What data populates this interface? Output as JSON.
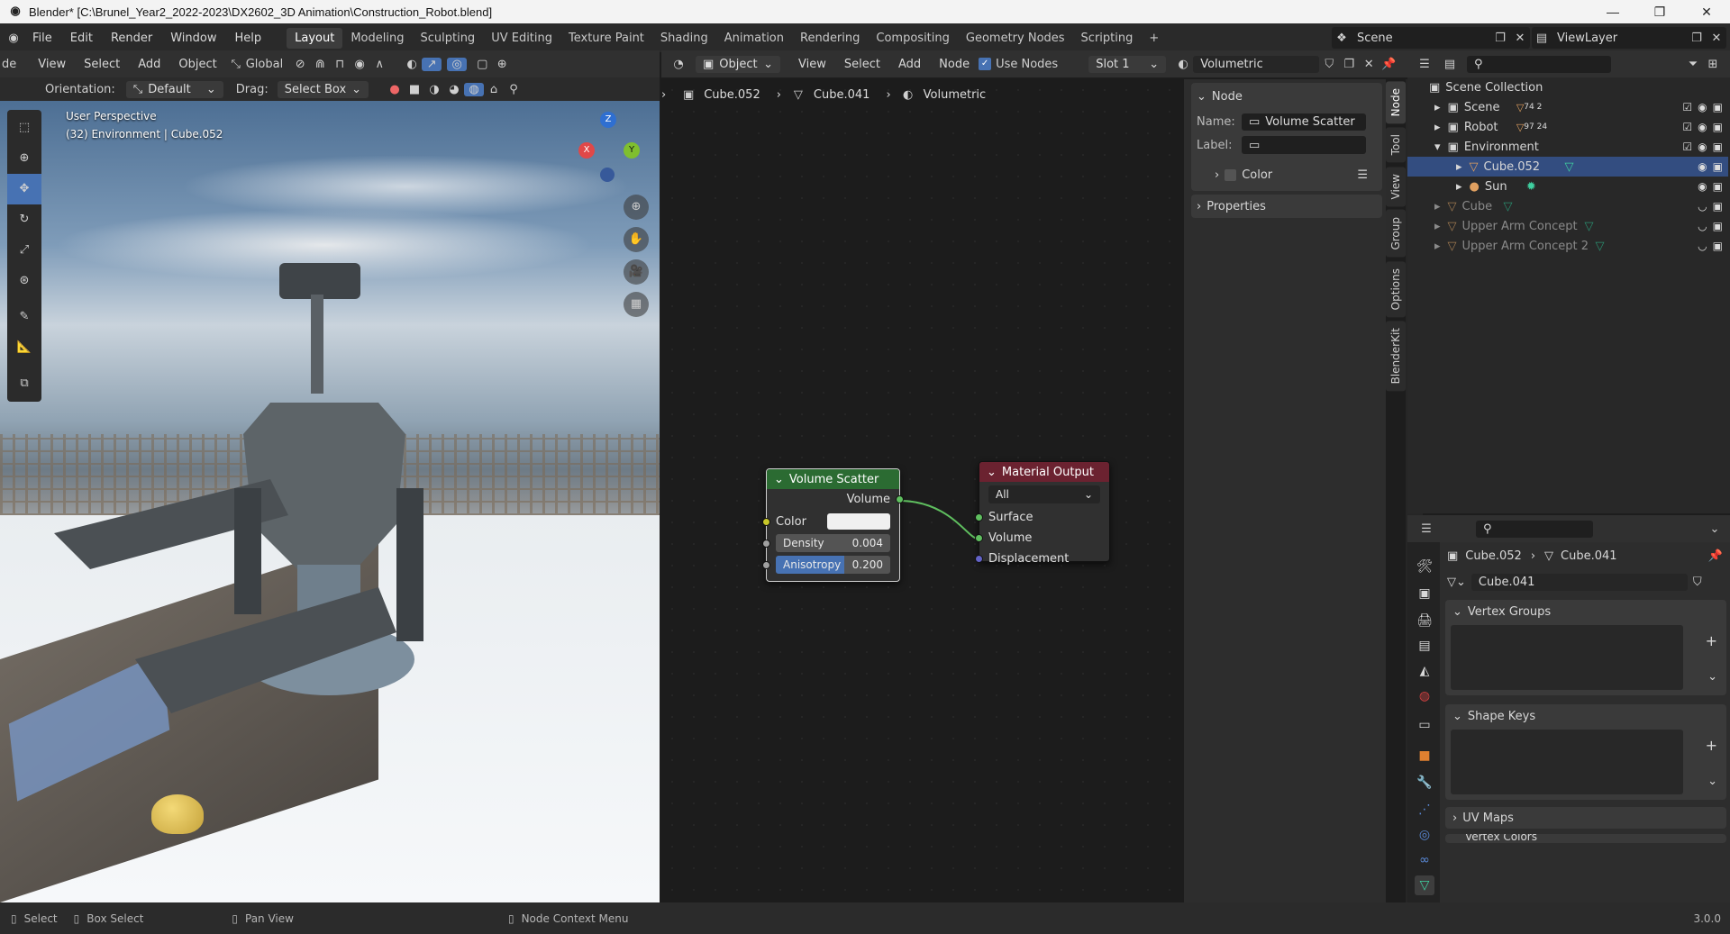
{
  "window": {
    "title": "Blender* [C:\\Brunel_Year2_2022-2023\\DX2602_3D Animation\\Construction_Robot.blend]",
    "minimize": "—",
    "maximize": "❐",
    "close": "✕"
  },
  "menu": {
    "items": [
      "File",
      "Edit",
      "Render",
      "Window",
      "Help"
    ],
    "workspaces": [
      "Layout",
      "Modeling",
      "Sculpting",
      "UV Editing",
      "Texture Paint",
      "Shading",
      "Animation",
      "Rendering",
      "Compositing",
      "Geometry Nodes",
      "Scripting"
    ],
    "add_ws": "+",
    "scene_label": "Scene",
    "viewlayer_label": "ViewLayer"
  },
  "viewport_header": {
    "mode": "de",
    "menus": [
      "View",
      "Select",
      "Add",
      "Object"
    ],
    "transform": "Global",
    "orientation_label": "Orientation:",
    "orientation_value": "Default",
    "drag_label": "Drag:",
    "drag_value": "Select Box"
  },
  "viewport": {
    "perspective": "User Perspective",
    "context": "(32) Environment | Cube.052",
    "gizmo": {
      "z": "Z",
      "x": "X",
      "y": "Y"
    }
  },
  "node_header": {
    "object_type": "Object",
    "menus": [
      "View",
      "Select",
      "Add",
      "Node"
    ],
    "use_nodes": "Use Nodes",
    "slot": "Slot 1",
    "material": "Volumetric"
  },
  "breadcrumb": [
    "Cube.052",
    "Cube.041",
    "Volumetric"
  ],
  "nodes": {
    "volume_scatter": {
      "title": "Volume Scatter",
      "output": "Volume",
      "color_label": "Color",
      "density_label": "Density",
      "density_value": "0.004",
      "anisotropy_label": "Anisotropy",
      "anisotropy_value": "0.200"
    },
    "material_output": {
      "title": "Material Output",
      "target": "All",
      "inputs": [
        "Surface",
        "Volume",
        "Displacement"
      ]
    }
  },
  "node_sidebar": {
    "section": "Node",
    "name_label": "Name:",
    "name_value": "Volume Scatter",
    "label_label": "Label:",
    "color": "Color",
    "properties": "Properties",
    "tabs": [
      "Node",
      "Tool",
      "View",
      "Group",
      "Options",
      "BlenderKit"
    ]
  },
  "outliner": {
    "root": "Scene Collection",
    "rows": [
      {
        "name": "Scene",
        "badge": "74  2"
      },
      {
        "name": "Robot",
        "badge": "97  24"
      },
      {
        "name": "Environment",
        "badge": ""
      },
      {
        "name": "Cube.052",
        "badge": ""
      },
      {
        "name": "Sun",
        "badge": ""
      },
      {
        "name": "Cube",
        "badge": ""
      },
      {
        "name": "Upper Arm Concept",
        "badge": ""
      },
      {
        "name": "Upper Arm Concept 2",
        "badge": ""
      }
    ]
  },
  "properties": {
    "breadcrumb_obj": "Cube.052",
    "breadcrumb_mesh": "Cube.041",
    "mesh_name": "Cube.041",
    "vertex_groups": "Vertex Groups",
    "shape_keys": "Shape Keys",
    "uv_maps": "UV Maps",
    "vertex_colors": "Vertex Colors"
  },
  "status": {
    "select": "Select",
    "box_select": "Box Select",
    "pan_view": "Pan View",
    "node_context": "Node Context Menu",
    "version": "3.0.0"
  },
  "colors": {
    "scatter_header": "#2b6b32",
    "output_header": "#6b2230",
    "selected_row": "#334d80",
    "accent_blue": "#4772b3"
  }
}
